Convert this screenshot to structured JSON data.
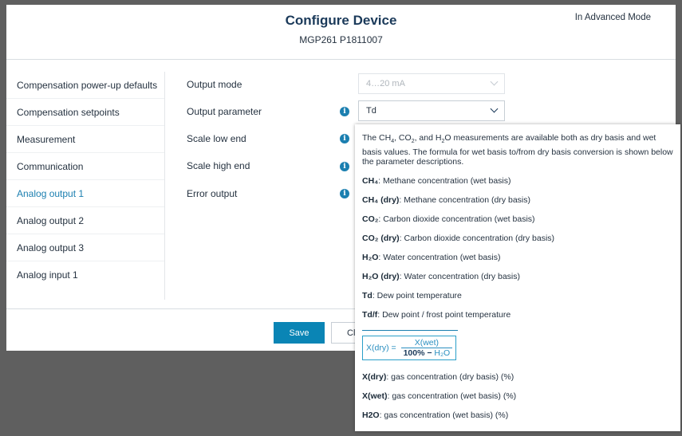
{
  "header": {
    "title": "Configure Device",
    "subtitle": "MGP261 P1811007",
    "mode": "In Advanced Mode"
  },
  "sidebar": {
    "items": [
      {
        "label": "Compensation power-up defaults"
      },
      {
        "label": "Compensation setpoints"
      },
      {
        "label": "Measurement"
      },
      {
        "label": "Communication"
      },
      {
        "label": "Analog output 1"
      },
      {
        "label": "Analog output 2"
      },
      {
        "label": "Analog output 3"
      },
      {
        "label": "Analog input 1"
      }
    ],
    "active": "Analog output 1"
  },
  "form": {
    "output_mode": {
      "label": "Output mode",
      "value": "4…20 mA"
    },
    "output_parameter": {
      "label": "Output parameter",
      "value": "Td"
    },
    "scale_low": {
      "label": "Scale low end"
    },
    "scale_high": {
      "label": "Scale high end"
    },
    "error_output": {
      "label": "Error output"
    }
  },
  "footer": {
    "save_label": "Save",
    "close_label": "Cl"
  },
  "popup": {
    "intro_1": "The CH",
    "intro_sub_1": "4",
    "intro_2": ", CO",
    "intro_sub_2": "2",
    "intro_3": ", and H",
    "intro_sub_3": "2",
    "intro_4": "O measurements are available both as dry basis and wet basis values. The formula for wet basis to/from dry basis conversion is shown below the parameter descriptions.",
    "params": [
      {
        "name": "CH₄",
        "desc": ": Methane concentration (wet basis)"
      },
      {
        "name": "CH₄ (dry)",
        "desc": ": Methane concentration (dry basis)"
      },
      {
        "name": "CO₂",
        "desc": ": Carbon dioxide concentration (wet basis)"
      },
      {
        "name": "CO₂ (dry)",
        "desc": ": Carbon dioxide concentration (dry basis)"
      },
      {
        "name": "H₂O",
        "desc": ": Water concentration (wet basis)"
      },
      {
        "name": "H₂O (dry)",
        "desc": ": Water concentration (dry basis)"
      },
      {
        "name": "Td",
        "desc": ": Dew point temperature"
      },
      {
        "name": "Td/f",
        "desc": ": Dew point / frost point temperature"
      }
    ],
    "formula": {
      "lhs": "X(dry) =",
      "numerator": "X(wet)",
      "denominator_a": "100% − ",
      "denominator_b": "H₂O"
    },
    "vars": [
      {
        "name": "X(dry)",
        "desc": ": gas concentration (dry basis) (%)"
      },
      {
        "name": "X(wet)",
        "desc": ": gas concentration (wet basis) (%)"
      },
      {
        "name": "H2O",
        "desc": ": gas concentration (wet basis) (%)"
      }
    ]
  },
  "icons": {
    "info": "info-icon",
    "chevron": "chevron-down-icon"
  },
  "colors": {
    "accent": "#0a85b5",
    "overlay": "#5f5f5f",
    "title": "#1b3a5a"
  }
}
